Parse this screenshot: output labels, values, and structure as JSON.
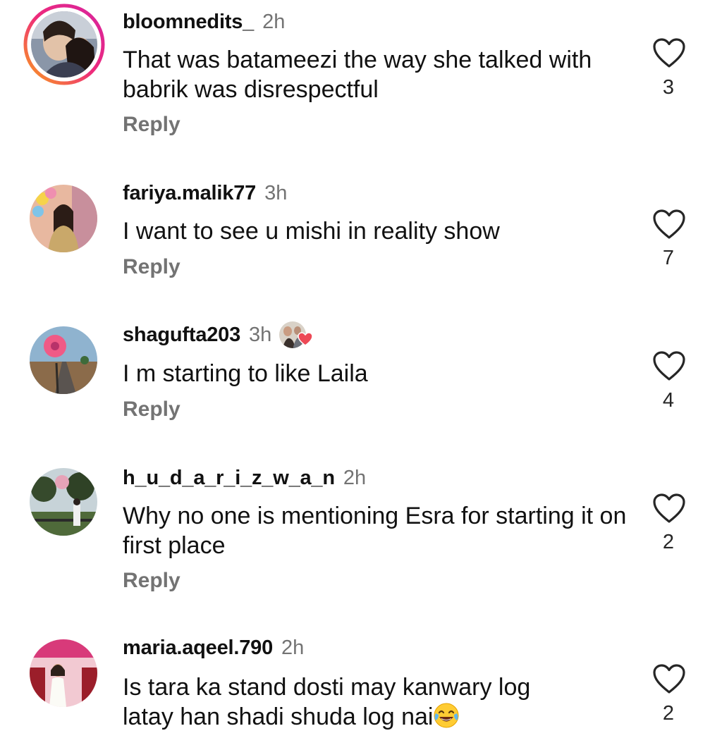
{
  "comments": [
    {
      "username": "bloomnedits_",
      "time": "2h",
      "text": "That was batameezi the way she talked with babrik was disrespectful",
      "reply_label": "Reply",
      "likes": "3",
      "avatar_icon": "profile-photo-couple",
      "has_story_ring": true
    },
    {
      "username": "fariya.malik77",
      "time": "3h",
      "text": "I want to see u mishi in reality show",
      "reply_label": "Reply",
      "likes": "7",
      "avatar_icon": "profile-photo-woman-balloons"
    },
    {
      "username": "shagufta203",
      "time": "3h",
      "text": "I m starting to like Laila",
      "reply_label": "Reply",
      "likes": "4",
      "avatar_icon": "profile-photo-pink-flower-road",
      "creator_reaction_icon": "creator-heart-reaction"
    },
    {
      "username": "h_u_d_a_r_i_z_w_a_n",
      "time": "2h",
      "text": "Why no one is mentioning Esra for starting it on first place",
      "reply_label": "Reply",
      "likes": "2",
      "avatar_icon": "profile-photo-park-trees"
    },
    {
      "username": "maria.aqeel.790",
      "time": "2h",
      "text_line1": "Is tara ka stand dosti may kanwary log",
      "text_line2": "latay han shadi shuda log nai",
      "emoji_icon": "laughing-tears-emoji",
      "likes": "2",
      "avatar_icon": "profile-photo-child-pink"
    }
  ],
  "colors": {
    "username": "#111111",
    "meta_gray": "#737373",
    "story_ring_start": "#f9a11b",
    "story_ring_end": "#d6249f",
    "heart_outline": "#262626",
    "reaction_heart": "#ed4956"
  }
}
